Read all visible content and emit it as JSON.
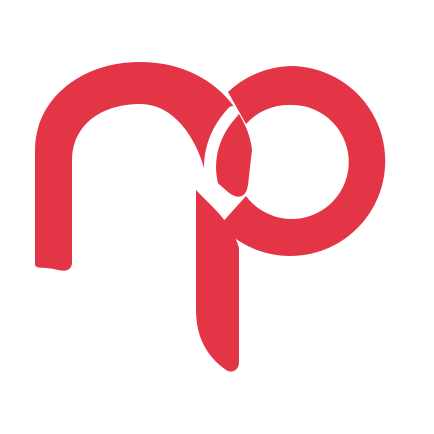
{
  "logo": {
    "name": "np-monogram-logo",
    "brand_color": "#E33546",
    "background_color": "#FFFFFF"
  }
}
